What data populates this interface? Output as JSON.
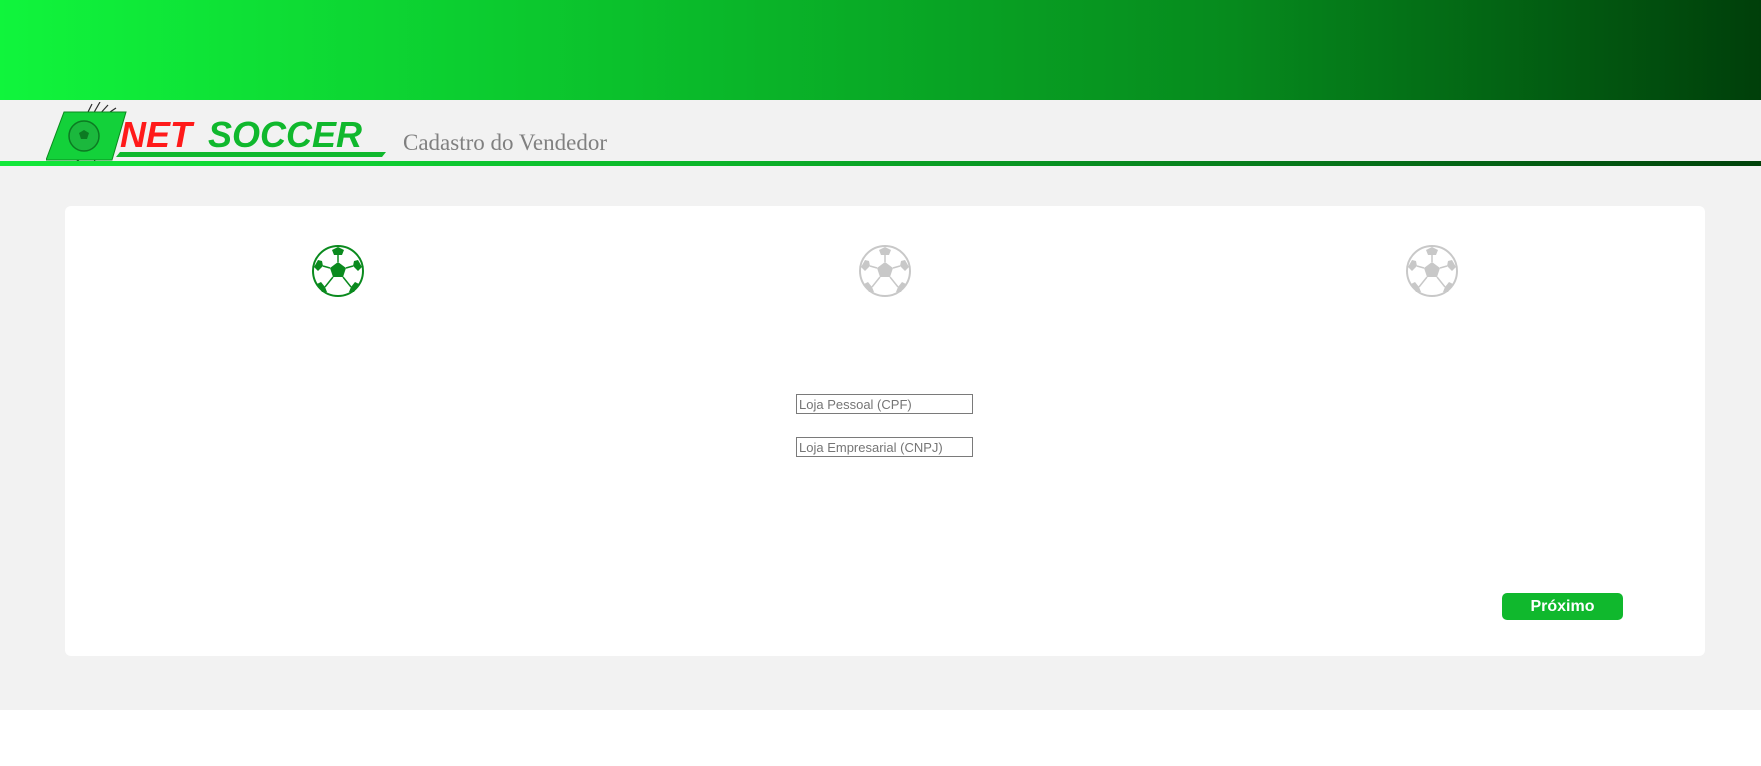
{
  "header": {
    "logo_text": "NETSOCCER",
    "page_title": "Cadastro do Vendedor"
  },
  "colors": {
    "banner_start": "#10f53c",
    "banner_end": "#003f0a",
    "accent_green": "#10b82d",
    "logo_red": "#ff1a1a",
    "step_active": "#0a8a1e",
    "step_inactive": "#c8c8c8"
  },
  "steps": [
    {
      "icon": "soccer-ball-icon",
      "state": "active"
    },
    {
      "icon": "soccer-ball-icon",
      "state": "inactive"
    },
    {
      "icon": "soccer-ball-icon",
      "state": "inactive"
    }
  ],
  "options": {
    "cpf_placeholder": "Loja Pessoal (CPF)",
    "cnpj_placeholder": "Loja Empresarial (CNPJ)"
  },
  "actions": {
    "next_label": "Próximo"
  }
}
